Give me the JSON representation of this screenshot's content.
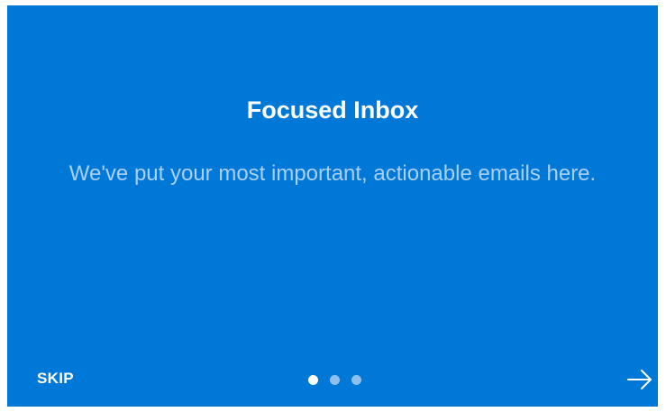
{
  "onboarding": {
    "title": "Focused Inbox",
    "description": "We've put your most important, actionable emails here.",
    "skip_label": "SKIP",
    "page_indicator": {
      "total": 3,
      "current": 1
    },
    "next_icon": "arrow-right-icon"
  },
  "colors": {
    "background": "#0078d7",
    "title": "#ffffff",
    "description": "#a9d0f5",
    "dot_active": "#ffffff",
    "dot_inactive": "#8ec0ed"
  }
}
